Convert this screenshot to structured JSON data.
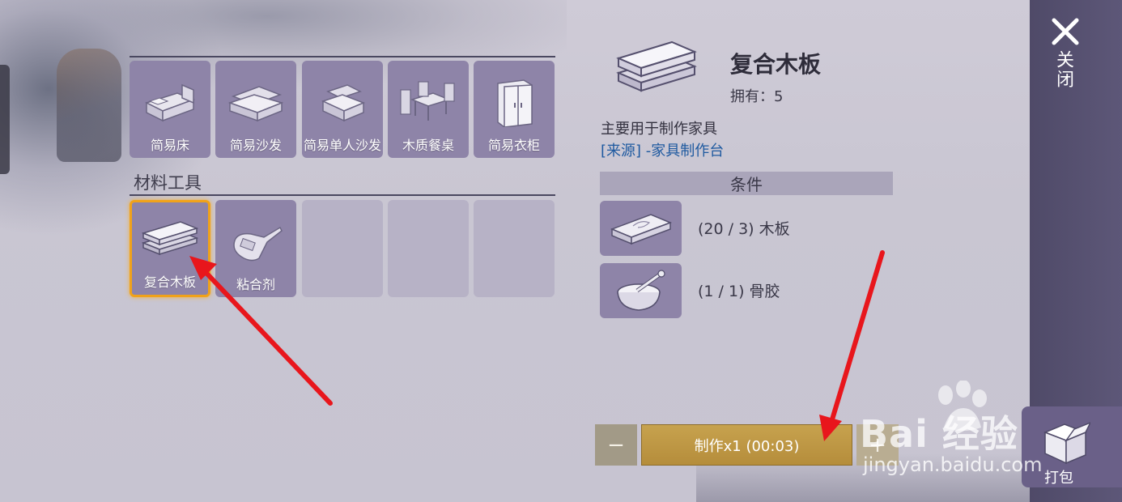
{
  "categories": {
    "furniture": {
      "items": [
        {
          "label": "简易床",
          "icon": "bed-icon"
        },
        {
          "label": "简易沙发",
          "icon": "sofa-icon"
        },
        {
          "label": "简易单人沙发",
          "icon": "armchair-icon"
        },
        {
          "label": "木质餐桌",
          "icon": "dining-table-icon"
        },
        {
          "label": "简易衣柜",
          "icon": "wardrobe-icon"
        }
      ]
    },
    "materials": {
      "title": "材料工具",
      "items": [
        {
          "label": "复合木板",
          "icon": "composite-board-icon",
          "selected": true
        },
        {
          "label": "粘合剂",
          "icon": "glue-bottle-icon",
          "selected": false
        }
      ],
      "empty_slots": 3
    }
  },
  "detail": {
    "name": "复合木板",
    "owned": "拥有：5",
    "description": "主要用于制作家具",
    "source": "[来源] -家具制作台",
    "conditions_title": "条件",
    "requirements": [
      {
        "text": "(20 / 3) 木板",
        "icon": "wood-plank-icon"
      },
      {
        "text": "(1 / 1) 骨胶",
        "icon": "mortar-bowl-icon"
      }
    ]
  },
  "craft": {
    "minus_label": "−",
    "plus_label": "+",
    "craft_label": "制作x1 (00:03)"
  },
  "rail": {
    "close_label": "关闭",
    "pack_label": "打包"
  },
  "watermark": {
    "main": "Bai 经验",
    "sub": "jingyan.baidu.com"
  },
  "colors": {
    "slot": "#8e84a8",
    "selected_border": "#f0a21a",
    "craft_button": "#b58d3b",
    "rail": "#4f4a68",
    "source_link": "#1f5aa0",
    "annotation_arrow": "#e8161c"
  }
}
